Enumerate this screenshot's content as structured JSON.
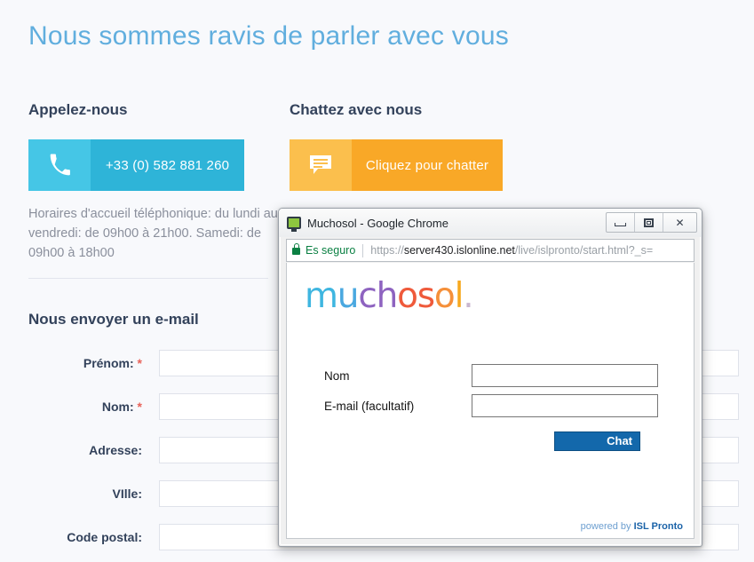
{
  "page": {
    "title": "Nous sommes ravis de parler avec vous",
    "call_heading": "Appelez-nous",
    "chat_heading": "Chattez avec nous",
    "phone_number": "+33 (0) 582 881 260",
    "chat_cta": "Cliquez pour chatter",
    "phone_icon": "phone-handset-icon",
    "chat_icon": "speech-bubble-icon",
    "hours": "Horaires d'accueil téléphonique: du lundi au vendredi: de 09h00 à 21h00. Samedi: de 09h00 à 18h00",
    "form_heading": "Nous envoyer un e-mail",
    "form_fields": [
      {
        "label": "Prénom:",
        "required": true,
        "value": ""
      },
      {
        "label": "Nom:",
        "required": true,
        "value": ""
      },
      {
        "label": "Adresse:",
        "required": false,
        "value": ""
      },
      {
        "label": "VIlle:",
        "required": false,
        "value": ""
      },
      {
        "label": "Code postal:",
        "required": false,
        "value": ""
      }
    ],
    "colors": {
      "background": "#f8f9fc",
      "title": "#61aede",
      "heading": "#33425b",
      "phone_icon_bg": "#45c6e6",
      "phone_text_bg": "#2eb4d8",
      "chat_icon_bg": "#fbbf4d",
      "chat_text_bg": "#f9a827",
      "required_star": "#e8635a",
      "muted_text": "#8a8f9c"
    }
  },
  "popup": {
    "window_title": "Muchosol - Google Chrome",
    "favicon": "chrome-monitor-icon",
    "controls": {
      "minimize": "minimize-icon",
      "restore": "restore-icon",
      "close": "✕"
    },
    "omnibox": {
      "lock_icon": "lock-icon",
      "security_label": "Es seguro",
      "url_scheme": "https://",
      "url_host": "server430.islonline.net",
      "url_path": "/live/islpronto/start.html?_s=",
      "url_full": "https://server430.islonline.net/live/islpronto/start.html?_s="
    },
    "content": {
      "logo_segments": [
        {
          "text": "m",
          "color": "#3fb6e0"
        },
        {
          "text": "u",
          "color": "#4aa8e0"
        },
        {
          "text": "c",
          "color": "#8e63c0"
        },
        {
          "text": "h",
          "color": "#8e63c0"
        },
        {
          "text": "o",
          "color": "#ef5a3b"
        },
        {
          "text": "s",
          "color": "#ef5a3b"
        },
        {
          "text": "o",
          "color": "#f5903a"
        },
        {
          "text": "l",
          "color": "#f7a81e"
        },
        {
          "text": ".",
          "color": "#c9b7cf"
        }
      ],
      "logo_text": "muchosol.",
      "fields": [
        {
          "label": "Nom",
          "value": "",
          "placeholder": ""
        },
        {
          "label": "E-mail (facultatif)",
          "value": "",
          "placeholder": ""
        }
      ],
      "submit_label": "Chat",
      "submit_color": "#1368ab",
      "powered_prefix": "powered by ",
      "powered_brand": "ISL Pronto"
    }
  }
}
